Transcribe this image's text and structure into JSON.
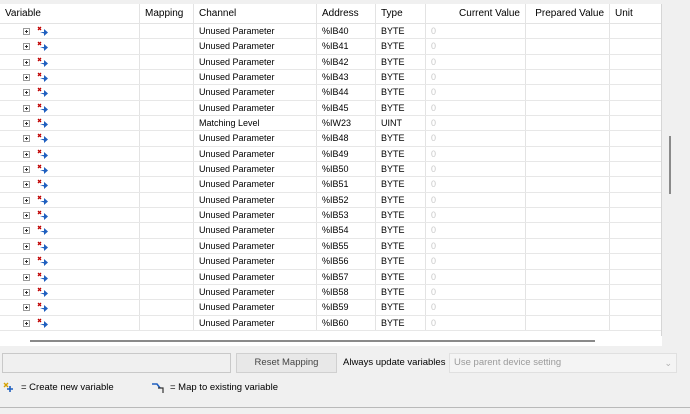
{
  "columns": {
    "variable": "Variable",
    "mapping": "Mapping",
    "channel": "Channel",
    "address": "Address",
    "type": "Type",
    "current_value": "Current Value",
    "prepared_value": "Prepared Value",
    "unit": "Unit"
  },
  "rows": [
    {
      "channel": "Unused Parameter",
      "address": "%IB40",
      "type": "BYTE",
      "current": "0"
    },
    {
      "channel": "Unused Parameter",
      "address": "%IB41",
      "type": "BYTE",
      "current": "0"
    },
    {
      "channel": "Unused Parameter",
      "address": "%IB42",
      "type": "BYTE",
      "current": "0"
    },
    {
      "channel": "Unused Parameter",
      "address": "%IB43",
      "type": "BYTE",
      "current": "0"
    },
    {
      "channel": "Unused Parameter",
      "address": "%IB44",
      "type": "BYTE",
      "current": "0"
    },
    {
      "channel": "Unused Parameter",
      "address": "%IB45",
      "type": "BYTE",
      "current": "0"
    },
    {
      "channel": "Matching Level",
      "address": "%IW23",
      "type": "UINT",
      "current": "0"
    },
    {
      "channel": "Unused Parameter",
      "address": "%IB48",
      "type": "BYTE",
      "current": "0"
    },
    {
      "channel": "Unused Parameter",
      "address": "%IB49",
      "type": "BYTE",
      "current": "0"
    },
    {
      "channel": "Unused Parameter",
      "address": "%IB50",
      "type": "BYTE",
      "current": "0"
    },
    {
      "channel": "Unused Parameter",
      "address": "%IB51",
      "type": "BYTE",
      "current": "0"
    },
    {
      "channel": "Unused Parameter",
      "address": "%IB52",
      "type": "BYTE",
      "current": "0"
    },
    {
      "channel": "Unused Parameter",
      "address": "%IB53",
      "type": "BYTE",
      "current": "0"
    },
    {
      "channel": "Unused Parameter",
      "address": "%IB54",
      "type": "BYTE",
      "current": "0"
    },
    {
      "channel": "Unused Parameter",
      "address": "%IB55",
      "type": "BYTE",
      "current": "0"
    },
    {
      "channel": "Unused Parameter",
      "address": "%IB56",
      "type": "BYTE",
      "current": "0"
    },
    {
      "channel": "Unused Parameter",
      "address": "%IB57",
      "type": "BYTE",
      "current": "0"
    },
    {
      "channel": "Unused Parameter",
      "address": "%IB58",
      "type": "BYTE",
      "current": "0"
    },
    {
      "channel": "Unused Parameter",
      "address": "%IB59",
      "type": "BYTE",
      "current": "0"
    },
    {
      "channel": "Unused Parameter",
      "address": "%IB60",
      "type": "BYTE",
      "current": "0"
    }
  ],
  "toolbar": {
    "reset_mapping": "Reset Mapping",
    "always_update_label": "Always update variables",
    "always_update_value": "Use parent device setting"
  },
  "legend": {
    "create_new": "= Create new variable",
    "map_existing": "= Map to existing variable"
  },
  "icons": {
    "expand": "expand-plus-icon",
    "variable": "map-variable-icon",
    "create_new": "create-new-variable-icon",
    "map_existing": "map-existing-variable-icon",
    "dropdown": "chevron-down-icon"
  },
  "colors": {
    "grid_line": "#e3e3e3",
    "muted_text": "#9a9a9a"
  }
}
